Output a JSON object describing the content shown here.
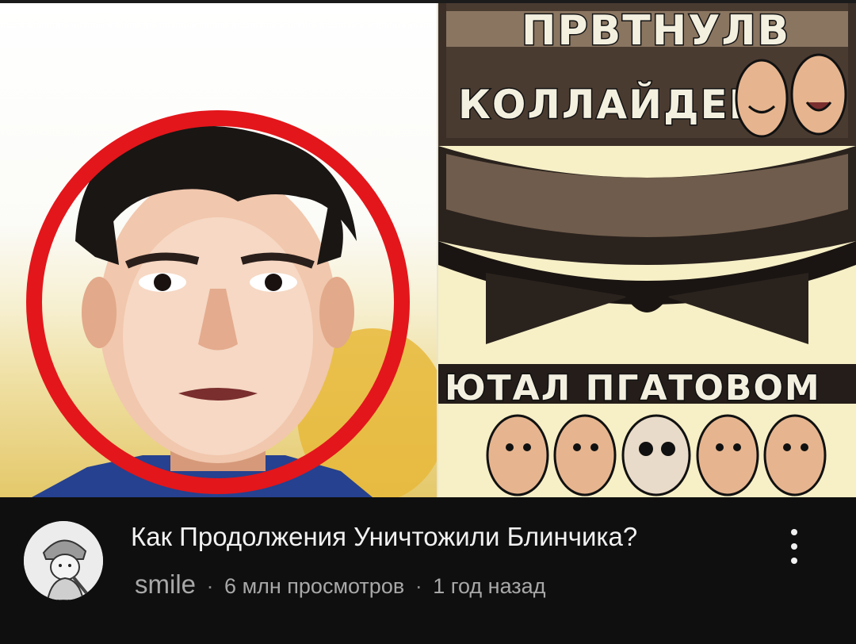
{
  "video": {
    "title": "Как Продолжения Уничтожили Блинчика?",
    "thumbnail": {
      "overlay_line_1": "ПРВТНУЛВ",
      "overlay_line_2": "КОЛЛАЙДЕР",
      "overlay_line_3": "ЮТАЛ ПГАТОВОМ"
    }
  },
  "channel": {
    "name": "smile"
  },
  "meta": {
    "separator": "·",
    "views": "6 млн просмотров",
    "age": "1 год назад"
  },
  "colors": {
    "background": "#0f0f0f",
    "title_text": "#f1f1f1",
    "meta_text": "#a8a8a8",
    "highlight_circle": "#e3161b"
  },
  "icons": {
    "more": "more-vertical-icon"
  }
}
